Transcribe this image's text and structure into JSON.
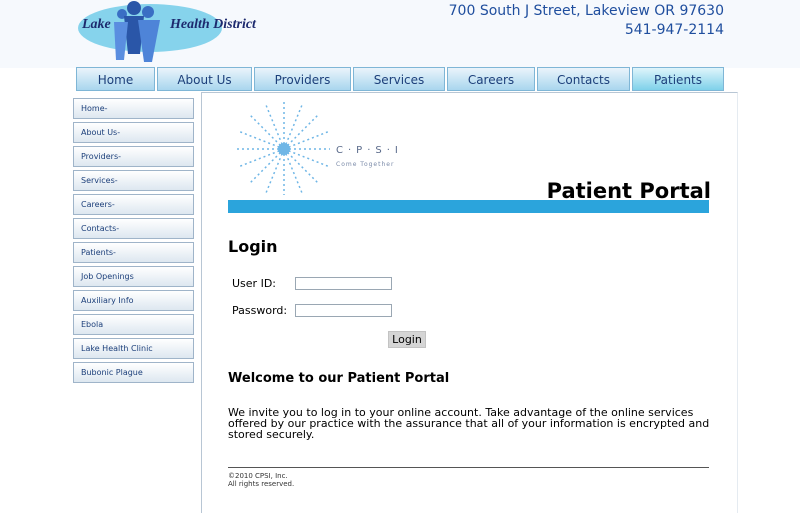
{
  "header": {
    "logo": {
      "left": "Lake",
      "right": "Health District"
    },
    "address": "700 South J Street, Lakeview OR 97630",
    "phone": "541-947-2114",
    "colors": {
      "brand_blue": "#1f4e9e",
      "accent": "#2ba4dc"
    }
  },
  "topnav": [
    "Home",
    "About Us",
    "Providers",
    "Services",
    "Careers",
    "Contacts",
    "Patients"
  ],
  "sidenav": [
    "Home-",
    "About Us-",
    "Providers-",
    "Services-",
    "Careers-",
    "Contacts-",
    "Patients-",
    "Job Openings",
    "Auxiliary Info",
    "Ebola",
    "Lake Health Clinic",
    "Bubonic Plague"
  ],
  "cpsi": {
    "letters": "C·P·S·I",
    "tagline": "Come Together"
  },
  "portal": {
    "title": "Patient Portal",
    "login_heading": "Login",
    "user_id_label": "User ID:",
    "password_label": "Password:",
    "user_id_value": "",
    "password_value": "",
    "login_button": "Login",
    "welcome_heading": "Welcome to our Patient Portal",
    "welcome_text": "We invite you to log in to your online account. Take advantage of the online services offered by our practice with the assurance that all of your information is encrypted and stored securely.",
    "copyright_line1": "©2010 CPSI, Inc.",
    "copyright_line2": "All rights reserved."
  }
}
